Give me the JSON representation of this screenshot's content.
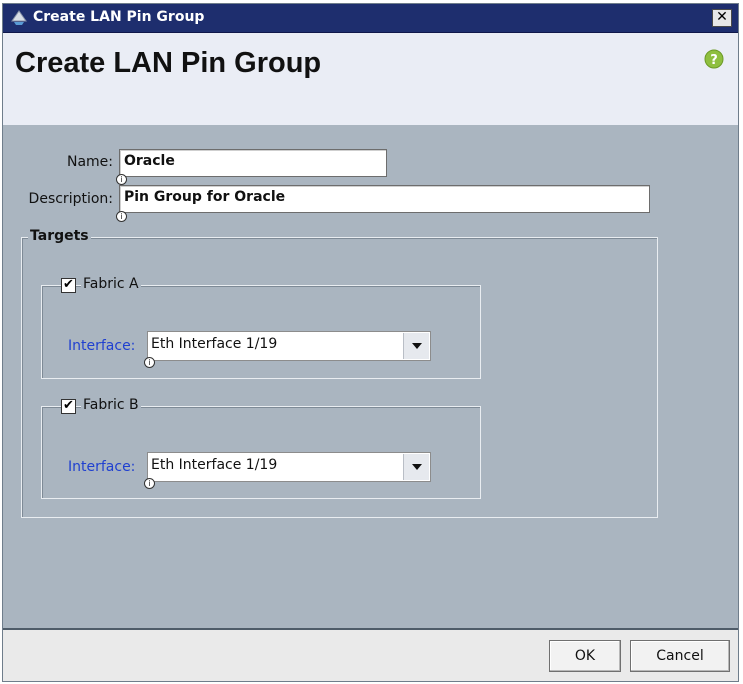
{
  "window": {
    "title": "Create LAN Pin Group",
    "close_label": "✕"
  },
  "header": {
    "title": "Create LAN Pin Group",
    "help_icon": "help-icon"
  },
  "form": {
    "name_label": "Name:",
    "name_value": "Oracle",
    "description_label": "Description:",
    "description_value": "Pin Group for Oracle",
    "info_mark": "i"
  },
  "targets": {
    "legend": "Targets",
    "fabrics": [
      {
        "label": "Fabric A",
        "checked": true,
        "interface_label": "Interface:",
        "interface_value": "Eth Interface 1/19"
      },
      {
        "label": "Fabric B",
        "checked": true,
        "interface_label": "Interface:",
        "interface_value": "Eth Interface 1/19"
      }
    ]
  },
  "footer": {
    "ok_label": "OK",
    "cancel_label": "Cancel"
  },
  "colors": {
    "titlebar": "#1e2e6e",
    "interface_label": "#2040d0",
    "help_icon": "#8fbf3f"
  }
}
